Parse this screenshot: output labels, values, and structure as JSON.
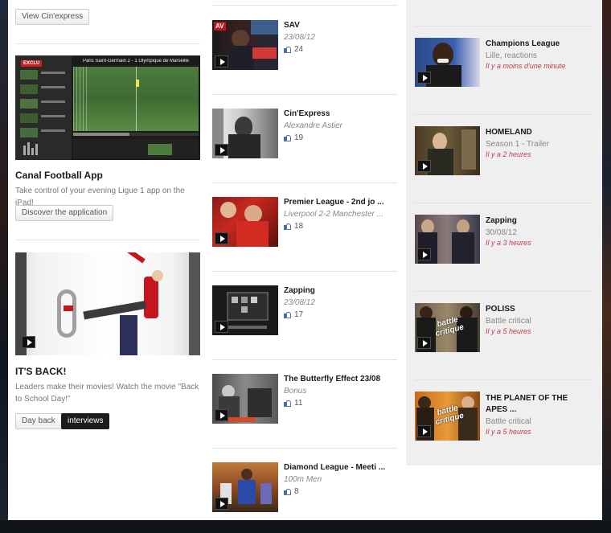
{
  "left": {
    "cinexpress_button": "View Cin'express",
    "feature1": {
      "title": "Canal Football App",
      "description": "Take control of your evening Ligue 1 app on the iPad!",
      "button": "Discover the application",
      "scoreboard": "Paris Saint-Germain 2 - 1 Olympique de Marseille",
      "badge": "EXCLU"
    },
    "feature2": {
      "title": "IT'S BACK!",
      "description": "Leaders make their movies! Watch the movie \"Back to School Day!\"",
      "buttons": [
        "Day back",
        "interviews"
      ]
    }
  },
  "middle": {
    "items": [
      {
        "title": "SAV",
        "subtitle": "23/08/12",
        "likes": "24",
        "badge": "AV"
      },
      {
        "title": "Cin'Express",
        "subtitle": "Alexandre Astier",
        "likes": "19"
      },
      {
        "title": "Premier League - 2nd jo ...",
        "subtitle": "Liverpool 2-2 Manchester ...",
        "likes": "18"
      },
      {
        "title": "Zapping",
        "subtitle": "23/08/12",
        "likes": "17"
      },
      {
        "title": "The Butterfly Effect 23/08",
        "subtitle": "Bonus",
        "likes": "11"
      },
      {
        "title": "Diamond League - Meeti ...",
        "subtitle": "100m Men",
        "likes": "8"
      }
    ]
  },
  "right": {
    "items": [
      {
        "title": "Champions League",
        "subtitle": "Lille, reactions",
        "time": "Il y a moins d'une minute"
      },
      {
        "title": "HOMELAND",
        "subtitle": "Season 1 - Trailer",
        "time": "Il y a 2 heures"
      },
      {
        "title": "Zapping",
        "subtitle": "30/08/12",
        "time": "Il y a 3 heures"
      },
      {
        "title": "POLISS",
        "subtitle": "Battle critical",
        "time": "Il y a 5 heures",
        "overlay": "battle critique"
      },
      {
        "title": "THE PLANET OF THE APES ...",
        "subtitle": "Battle critical",
        "time": "Il y a 5 heures",
        "overlay": "battle critique"
      }
    ]
  },
  "colors": {
    "time_red": "#c0394b",
    "like_blue": "#4a6fa5",
    "sidebar_bg": "#efefef"
  }
}
